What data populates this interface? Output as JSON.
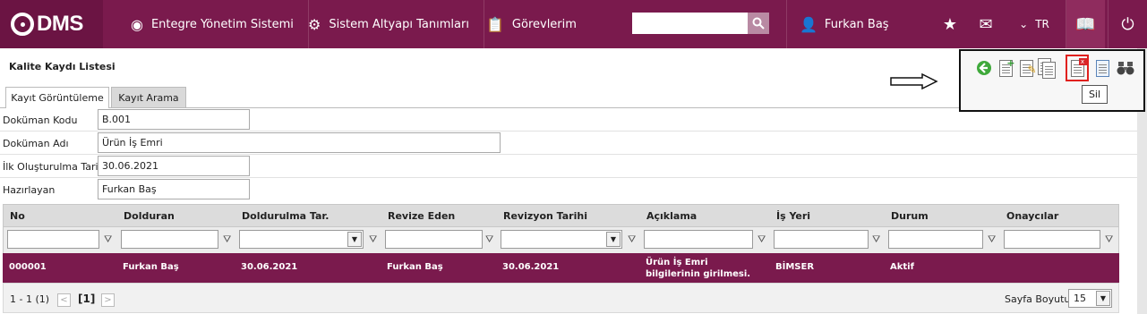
{
  "app": {
    "logo_text": "DMS"
  },
  "nav": [
    {
      "label": "Entegre Yönetim Sistemi",
      "icon": "q-logo-icon"
    },
    {
      "label": "Sistem Altyapı Tanımları",
      "icon": "gear-icon"
    },
    {
      "label": "Görevlerim",
      "icon": "clipboard-icon"
    }
  ],
  "search": {
    "value": ""
  },
  "user": {
    "name": "Furkan Baş"
  },
  "topbar": {
    "language": "TR"
  },
  "page": {
    "title": "Kalite Kaydı Listesi"
  },
  "tabs": [
    {
      "label": "Kayıt Görüntüleme",
      "active": true
    },
    {
      "label": "Kayıt Arama",
      "active": false
    }
  ],
  "form": {
    "fields": [
      {
        "label": "Doküman Kodu",
        "value": "B.001"
      },
      {
        "label": "Doküman Adı",
        "value": "Ürün İş Emri"
      },
      {
        "label": "İlk Oluşturulma Tarihi",
        "value": "30.06.2021"
      },
      {
        "label": "Hazırlayan",
        "value": "Furkan Baş"
      }
    ]
  },
  "grid": {
    "columns": [
      "No",
      "Dolduran",
      "Doldurulma Tar.",
      "Revize Eden",
      "Revizyon Tarihi",
      "Açıklama",
      "İş Yeri",
      "Durum",
      "Onaycılar"
    ],
    "rows": [
      {
        "no": "000001",
        "dolduran": "Furkan Baş",
        "tarih": "30.06.2021",
        "revize_eden": "Furkan Baş",
        "revizyon_tarihi": "30.06.2021",
        "aciklama": "Ürün İş Emri bilgilerinin girilmesi.",
        "is_yeri": "BİMSER",
        "durum": "Aktif",
        "onaycilar": ""
      }
    ]
  },
  "pager": {
    "range": "1 - 1 (1)",
    "current_page": "[1]",
    "page_size_label": "Sayfa Boyutu:",
    "page_size": "15"
  },
  "tooltip": {
    "text": "Sil"
  },
  "colors": {
    "brand": "#7a1a4d",
    "highlight_box": "#e0201e"
  }
}
